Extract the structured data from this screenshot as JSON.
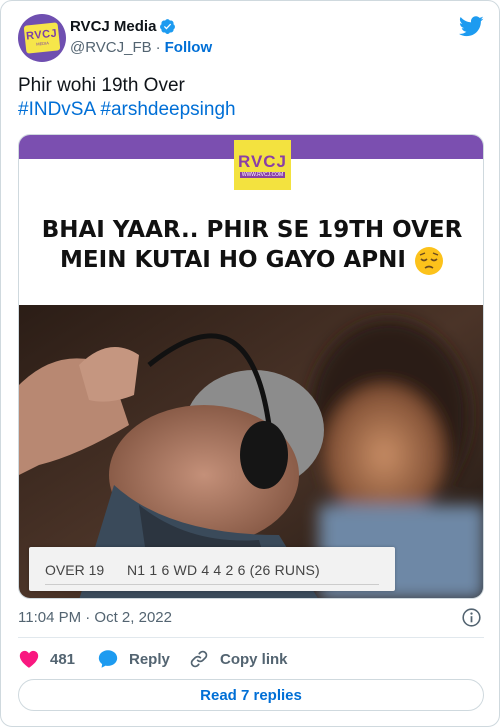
{
  "author": {
    "name": "RVCJ Media",
    "handle": "@RVCJ_FB",
    "separator": "·",
    "follow_label": "Follow",
    "avatar_text": "RVCJ",
    "avatar_subtext": "MEDIA"
  },
  "tweet": {
    "text": "Phir wohi 19th Over",
    "hashtags": [
      "#INDvSA",
      "#arshdeepsingh"
    ]
  },
  "media": {
    "logo_text": "RVCJ",
    "logo_url_text": "WWW.RVCJ.COM",
    "caption_line1": "BHAI YAAR.. PHIR SE 19TH OVER",
    "caption_line2": "MEIN KUTAI HO GAYO APNI",
    "scoreboard_over": "OVER 19",
    "scoreboard_balls": "N1 1 6 WD 4 4 2 6 (26 RUNS)"
  },
  "meta": {
    "timestamp": "11:04 PM · Oct 2, 2022"
  },
  "actions": {
    "like_count": "481",
    "reply_label": "Reply",
    "copy_link_label": "Copy link",
    "read_replies_label": "Read 7 replies"
  },
  "colors": {
    "link_blue": "#006fd6",
    "twitter_blue": "#1d9bf0",
    "like_pink": "#f91880",
    "media_purple": "#7b4fb0",
    "logo_yellow": "#f3e23f"
  }
}
